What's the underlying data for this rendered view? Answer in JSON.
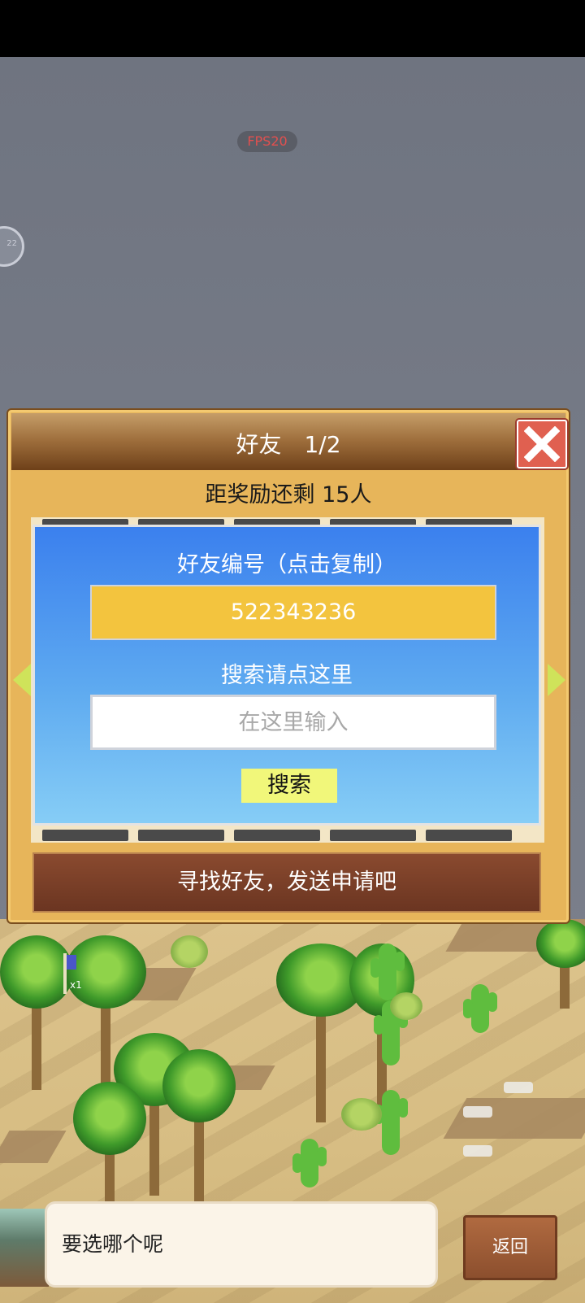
{
  "overlay": {
    "fps_label": "FPS20",
    "float_ball_label": "22"
  },
  "friend_dialog": {
    "title": "好友　1/2",
    "reward_text": "距奖励还剩 15人",
    "id_label": "好友编号（点击复制）",
    "id_value": "522343236",
    "search_label": "搜索请点这里",
    "search_placeholder": "在这里输入",
    "search_button": "搜索",
    "find_friends_text": "寻找好友，发送申请吧"
  },
  "bottom": {
    "dialog_text": "要选哪个呢",
    "back_button": "返回",
    "unit_count": "x1"
  },
  "colors": {
    "panel_blue": "#3b80ee",
    "id_box_yellow": "#f3c43e",
    "close_red": "#e06050",
    "search_button": "#f1f77a"
  },
  "icons": [
    "close-icon",
    "left-arrow-icon",
    "right-arrow-icon"
  ]
}
